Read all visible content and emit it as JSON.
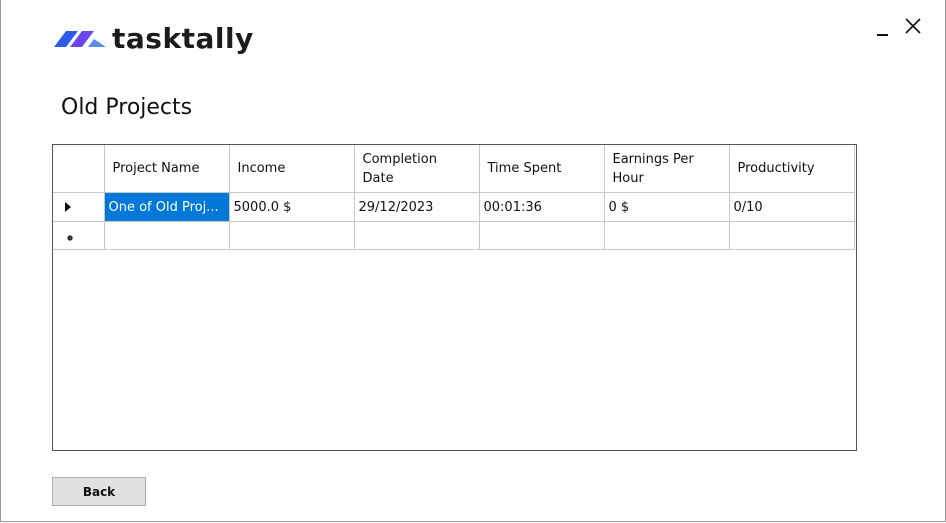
{
  "app": {
    "brand_name": "tasktally",
    "brand_colors": [
      "#2f5bea",
      "#6b46e8",
      "#5a8cf0"
    ]
  },
  "window": {
    "minimize_icon": "minimize-icon",
    "close_icon": "close-icon"
  },
  "page": {
    "title": "Old Projects"
  },
  "grid": {
    "columns": [
      "Project Name",
      "Income",
      "Completion Date",
      "Time Spent",
      "Earnings Per Hour",
      "Productivity"
    ],
    "rows": [
      {
        "indicator": "current-row-arrow",
        "cells": [
          "One of Old Proj...",
          "5000.0 $",
          "29/12/2023",
          "00:01:36",
          "0 $",
          "0/10"
        ],
        "selected_column": 0
      }
    ],
    "new_row_indicator": "new-row-star",
    "selection_color": "#0078d7"
  },
  "footer": {
    "back_label": "Back"
  }
}
